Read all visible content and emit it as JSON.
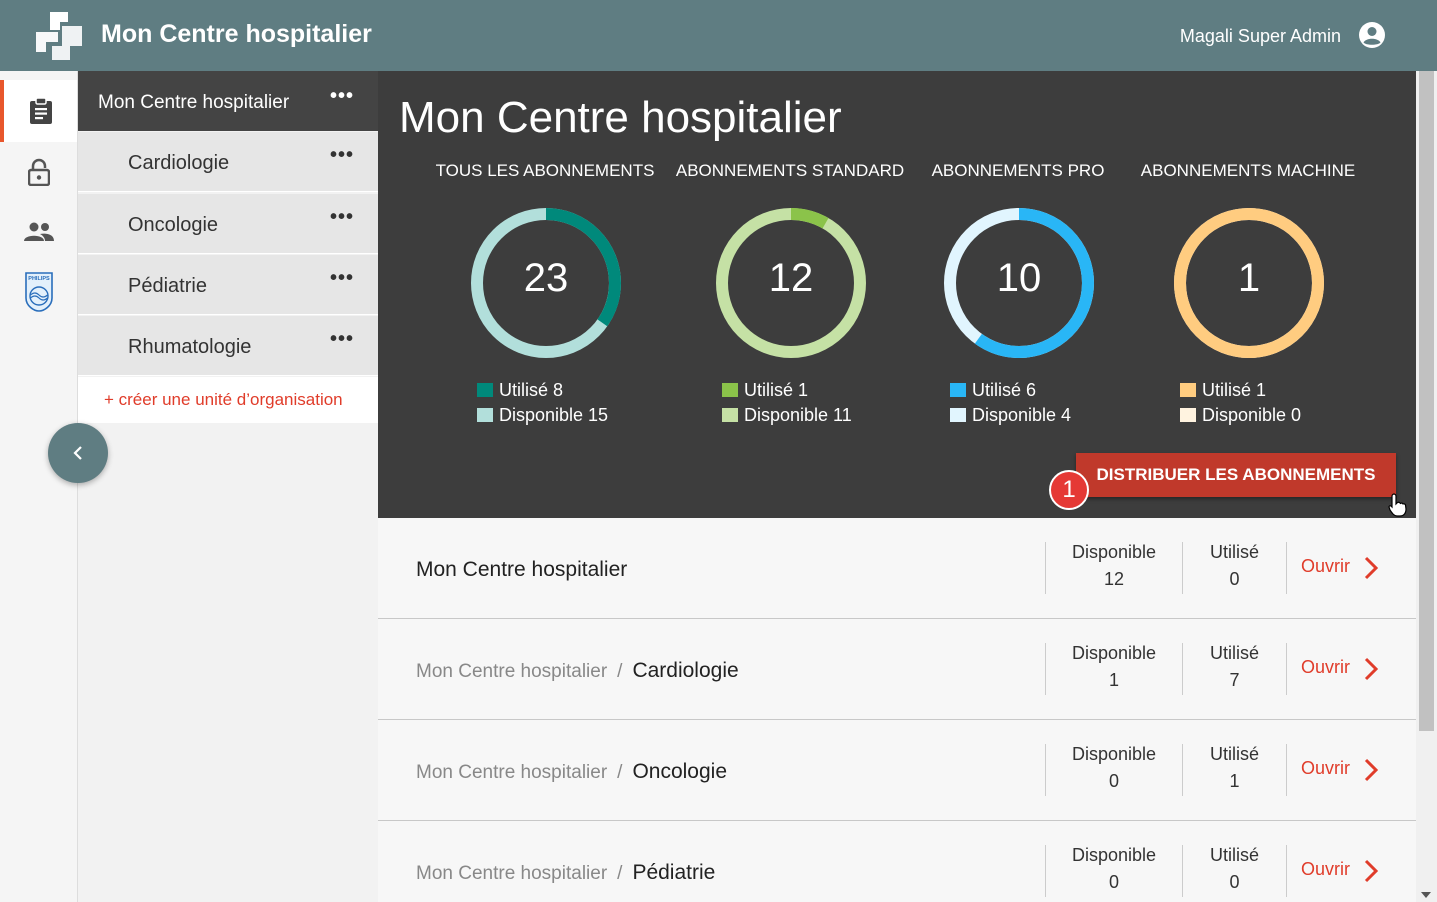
{
  "header": {
    "title": "Mon Centre hospitalier",
    "user_name": "Magali Super Admin",
    "icons": [
      "app-logo-icon",
      "account-circle-icon"
    ]
  },
  "rail": {
    "items": [
      {
        "icon": "clipboard-icon",
        "active": true
      },
      {
        "icon": "lock-icon",
        "active": false
      },
      {
        "icon": "people-icon",
        "active": false
      },
      {
        "icon": "philips-logo-icon",
        "active": false,
        "text": "PHILIPS"
      }
    ]
  },
  "tree": {
    "root": "Mon Centre hospitalier",
    "more": "•••",
    "items": [
      "Cardiologie",
      "Oncologie",
      "Pédiatrie",
      "Rhumatologie"
    ],
    "create_label": "+ créer une unité d’organisation"
  },
  "summary": {
    "title": "Mon Centre hospitalier",
    "columns": [
      {
        "title": "TOUS LES ABONNEMENTS",
        "total": "23",
        "used_label": "Utilisé 8",
        "available_label": "Disponible 15",
        "used": 8,
        "available": 15,
        "used_color": "#00897b",
        "available_color": "#b2dfdb"
      },
      {
        "title": "ABONNEMENTS STANDARD",
        "total": "12",
        "used_label": "Utilisé 1",
        "available_label": "Disponible 11",
        "used": 1,
        "available": 11,
        "used_color": "#8bc34a",
        "available_color": "#c5e1a5"
      },
      {
        "title": "ABONNEMENTS PRO",
        "total": "10",
        "used_label": "Utilisé 6",
        "available_label": "Disponible 4",
        "used": 6,
        "available": 4,
        "used_color": "#29b6f6",
        "available_color": "#e1f5fe"
      },
      {
        "title": "ABONNEMENTS MACHINE",
        "total": "1",
        "used_label": "Utilisé 1",
        "available_label": "Disponible 0",
        "used": 1,
        "available": 0,
        "used_color": "#ffcc80",
        "available_color": "#fff3e0"
      }
    ],
    "distribute_label": "DISTRIBUER LES ABONNEMENTS",
    "step_badge": "1"
  },
  "list": {
    "available_label": "Disponible",
    "used_label": "Utilisé",
    "open_label": "Ouvrir",
    "separator": "/",
    "rows": [
      {
        "parent": "",
        "name": "Mon Centre hospitalier",
        "available": "12",
        "used": "0"
      },
      {
        "parent": "Mon Centre hospitalier",
        "name": "Cardiologie",
        "available": "1",
        "used": "7"
      },
      {
        "parent": "Mon Centre hospitalier",
        "name": "Oncologie",
        "available": "0",
        "used": "1"
      },
      {
        "parent": "Mon Centre hospitalier",
        "name": "Pédiatrie",
        "available": "0",
        "used": "0"
      }
    ]
  }
}
